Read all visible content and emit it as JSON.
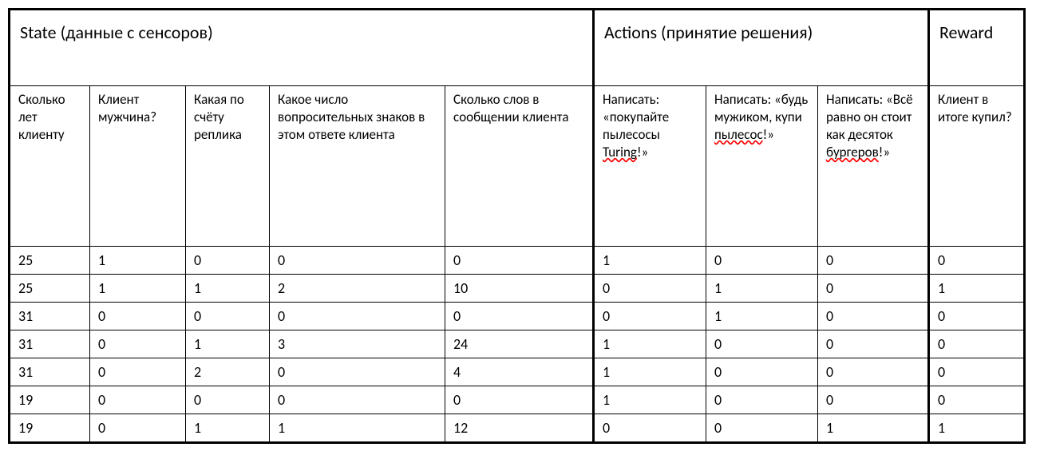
{
  "sections": {
    "state": {
      "title": "State (данные с сенсоров)",
      "columns": [
        "Сколько лет клиенту",
        "Клиент мужчина?",
        "Какая по счёту реплика",
        "Какое число вопросительных знаков в этом ответе клиента",
        "Сколько слов в сообщении клиента"
      ]
    },
    "actions": {
      "title": "Actions (принятие решения)",
      "col0_prefix": "Написать: «покупайте пылесосы ",
      "col0_squiggle": "Turing",
      "col0_suffix": "!»",
      "col1_prefix": "Написать: «будь мужиком, купи ",
      "col1_squiggle": "пылесос",
      "col1_suffix": "!»",
      "col2_prefix": "Написать: «Всё равно он стоит как десяток ",
      "col2_squiggle": "бургеров",
      "col2_suffix": "!»"
    },
    "reward": {
      "title": "Reward",
      "columns": [
        "Клиент в итоге купил?"
      ]
    }
  },
  "chart_data": {
    "type": "table",
    "columns": [
      "Сколько лет клиенту",
      "Клиент мужчина?",
      "Какая по счёту реплика",
      "Какое число вопросительных знаков в этом ответе клиента",
      "Сколько слов в сообщении клиента",
      "Написать: «покупайте пылесосы Turing!»",
      "Написать: «будь мужиком, купи пылесос!»",
      "Написать: «Всё равно он стоит как десяток бургеров!»",
      "Клиент в итоге купил?"
    ],
    "rows": [
      [
        25,
        1,
        0,
        0,
        0,
        1,
        0,
        0,
        0
      ],
      [
        25,
        1,
        1,
        2,
        10,
        0,
        1,
        0,
        1
      ],
      [
        31,
        0,
        0,
        0,
        0,
        0,
        1,
        0,
        0
      ],
      [
        31,
        0,
        1,
        3,
        24,
        1,
        0,
        0,
        0
      ],
      [
        31,
        0,
        2,
        0,
        4,
        1,
        0,
        0,
        0
      ],
      [
        19,
        0,
        0,
        0,
        0,
        1,
        0,
        0,
        0
      ],
      [
        19,
        0,
        1,
        1,
        12,
        0,
        0,
        1,
        1
      ]
    ]
  }
}
